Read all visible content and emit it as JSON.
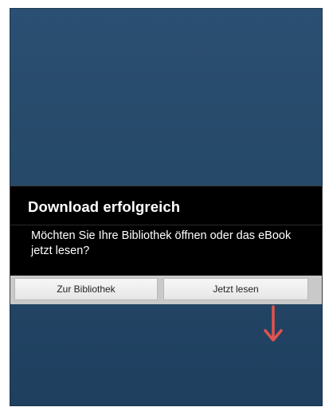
{
  "dialog": {
    "title": "Download erfolgreich",
    "message": "Möchten Sie Ihre Bibliothek öffnen oder das eBook jetzt lesen?",
    "buttons": {
      "library_label": "Zur Bibliothek",
      "read_label": "Jetzt lesen"
    }
  },
  "colors": {
    "background": "#244766",
    "dialog_background": "#000000",
    "arrow": "#e0534f"
  },
  "icons": {
    "arrow": "arrow-down-icon"
  }
}
